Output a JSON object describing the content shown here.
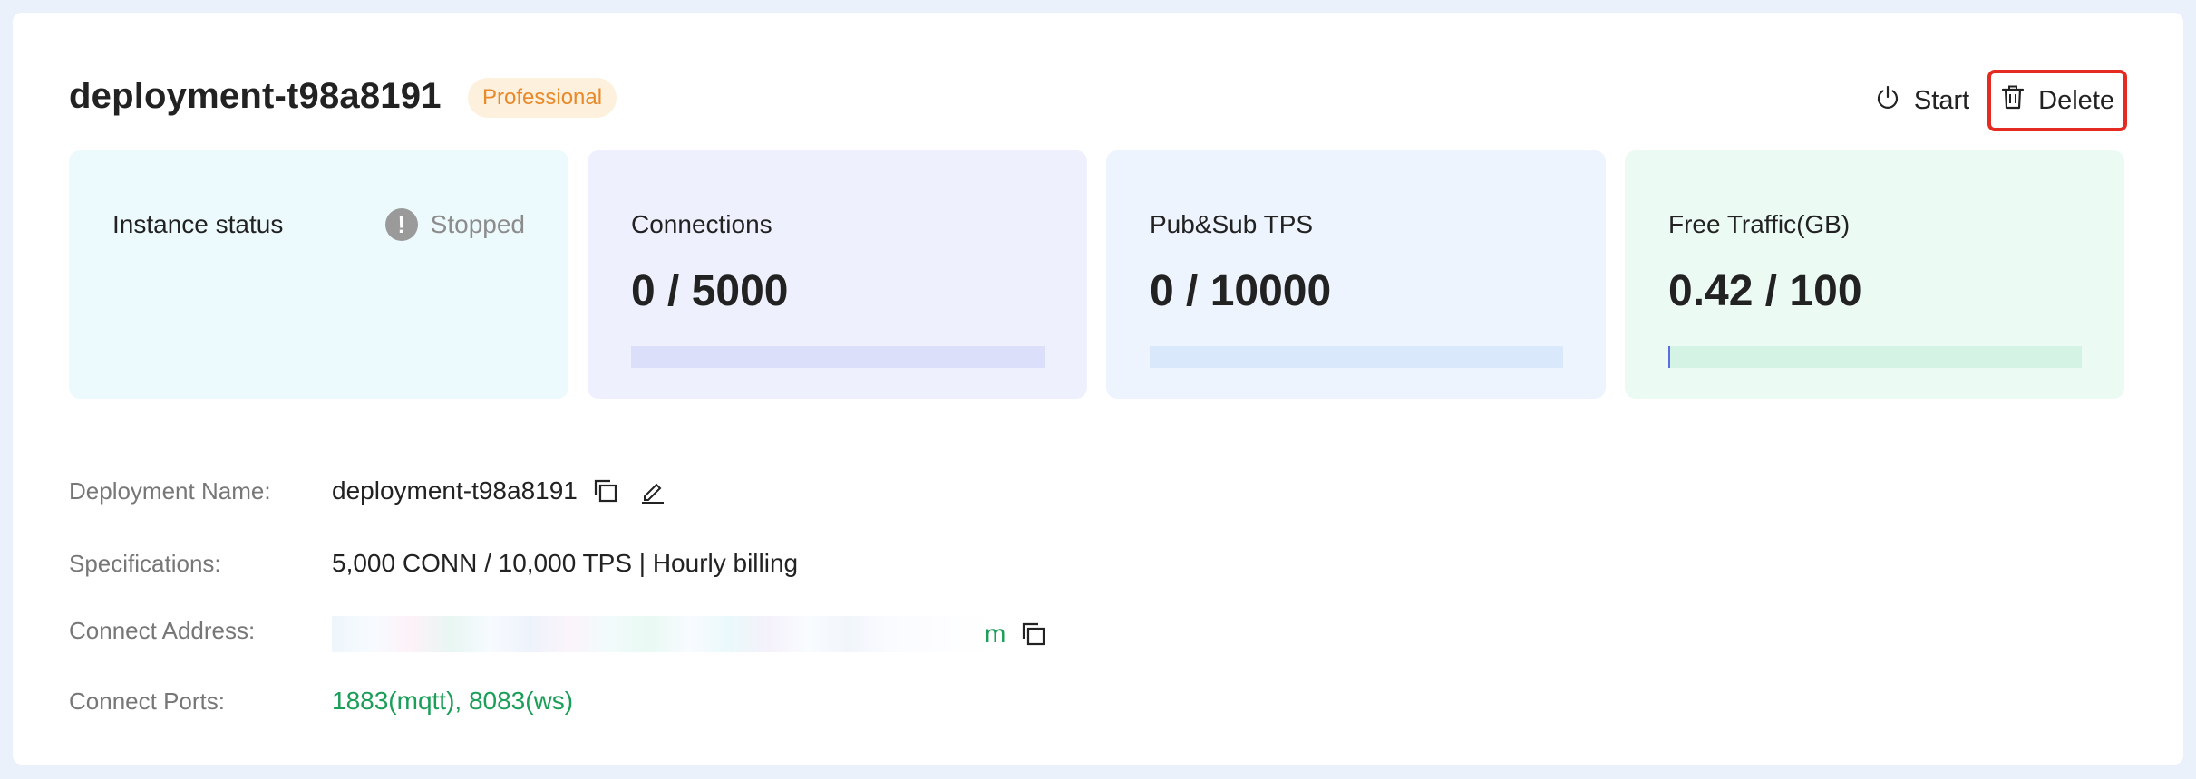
{
  "deployment": {
    "title": "deployment-t98a8191",
    "plan_badge": "Professional"
  },
  "actions": {
    "start_label": "Start",
    "delete_label": "Delete"
  },
  "cards": {
    "status": {
      "label": "Instance status",
      "value": "Stopped",
      "bg": "#ecfafd"
    },
    "connections": {
      "label": "Connections",
      "value": "0 / 5000",
      "progress": 0,
      "bg": "#eef1fd",
      "bar": "#dcdffa"
    },
    "tps": {
      "label": "Pub&Sub TPS",
      "value": "0 / 10000",
      "progress": 0,
      "bg": "#edf4fd",
      "bar": "#d9e8fb"
    },
    "traffic": {
      "label": "Free Traffic(GB)",
      "value": "0.42 / 100",
      "progress": 0.0042,
      "bg": "#ecfaf4",
      "bar": "#d5f3e5"
    }
  },
  "details": {
    "name_label": "Deployment Name:",
    "name_value": "deployment-t98a8191",
    "spec_label": "Specifications:",
    "spec_value": "5,000 CONN / 10,000 TPS | Hourly billing",
    "address_label": "Connect Address:",
    "address_value_visible": "m",
    "ports_label": "Connect Ports:",
    "ports_value": "1883(mqtt), 8083(ws)"
  }
}
